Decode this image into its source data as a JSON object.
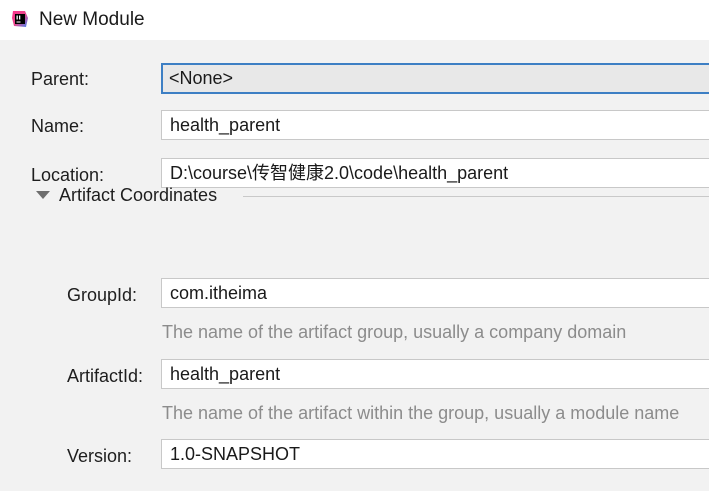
{
  "window": {
    "title": "New Module",
    "icon": "intellij-idea-icon"
  },
  "form": {
    "parent": {
      "label": "Parent:",
      "value": "<None>"
    },
    "name": {
      "label": "Name:",
      "value": "health_parent"
    },
    "location": {
      "label": "Location:",
      "value": "D:\\course\\传智健康2.0\\code\\health_parent"
    }
  },
  "artifact": {
    "section_label": "Artifact Coordinates",
    "expand_icon": "triangle-down-icon",
    "group_id": {
      "label": "GroupId:",
      "value": "com.itheima",
      "hint": "The name of the artifact group, usually a company domain"
    },
    "artifact_id": {
      "label": "ArtifactId:",
      "value": "health_parent",
      "hint": "The name of the artifact within the group, usually a module name"
    },
    "version": {
      "label": "Version:",
      "value": "1.0-SNAPSHOT"
    }
  },
  "colors": {
    "focus_border": "#3d7fc4",
    "background": "#f2f2f2",
    "hint_text": "#8c8c8c"
  }
}
